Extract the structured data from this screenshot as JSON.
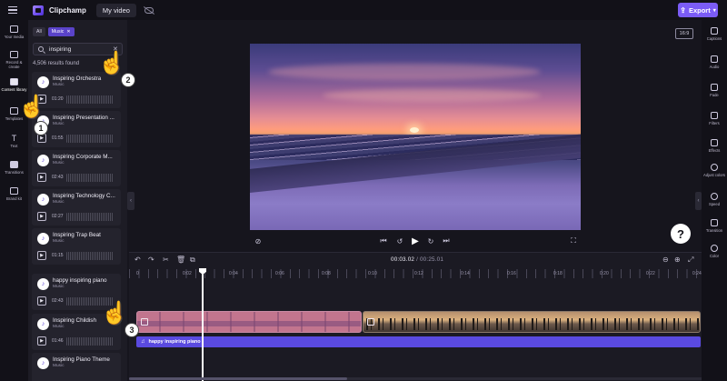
{
  "app": {
    "brand": "Clipchamp",
    "project_name": "My video",
    "export_label": "Export"
  },
  "left_rail": [
    {
      "label": "Your media",
      "icon": "media-icon"
    },
    {
      "label": "Record & create",
      "icon": "record-icon"
    },
    {
      "label": "Content library",
      "icon": "library-icon",
      "active": true
    },
    {
      "label": "Templates",
      "icon": "templates-icon"
    },
    {
      "label": "Text",
      "icon": "text-icon"
    },
    {
      "label": "Transitions",
      "icon": "transitions-icon"
    },
    {
      "label": "Brand kit",
      "icon": "brand-kit-icon"
    }
  ],
  "library": {
    "filter_all": "All",
    "filter_music": "Music",
    "search_value": "inspiring",
    "results_count": "4,506 results found",
    "items": [
      {
        "title": "Inspiring Orchestra",
        "type": "Music",
        "duration": "01:20"
      },
      {
        "title": "Inspiring Presentation ...",
        "type": "Music",
        "duration": "01:55"
      },
      {
        "title": "Inspiring Corporate M...",
        "type": "Music",
        "duration": "02:43"
      },
      {
        "title": "Inspiring Technology C...",
        "type": "Music",
        "duration": "02:27"
      },
      {
        "title": "Inspiring Trap Beat",
        "type": "Music",
        "duration": "01:15"
      },
      {
        "title": "happy inspiring piano",
        "type": "Music",
        "duration": "02:43"
      },
      {
        "title": "Inspiring Childish",
        "type": "Music",
        "duration": "01:46"
      },
      {
        "title": "Inspiring Piano Theme",
        "type": "Music",
        "duration": ""
      }
    ]
  },
  "preview": {
    "aspect_ratio": "16:9",
    "help": "?"
  },
  "right_rail": [
    {
      "label": "Captions",
      "icon": "captions-icon"
    },
    {
      "label": "Audio",
      "icon": "audio-icon"
    },
    {
      "label": "Fade",
      "icon": "fade-icon"
    },
    {
      "label": "Filters",
      "icon": "filters-icon"
    },
    {
      "label": "Effects",
      "icon": "effects-icon"
    },
    {
      "label": "Adjust colors",
      "icon": "adjust-colors-icon"
    },
    {
      "label": "Speed",
      "icon": "speed-icon"
    },
    {
      "label": "Transition",
      "icon": "transition-icon"
    },
    {
      "label": "Color",
      "icon": "color-icon"
    }
  ],
  "timeline": {
    "current_time": "00:03.02",
    "total_time": "/ 00:25.01",
    "ruler_ticks": [
      "0",
      "0:02",
      "0:04",
      "0:06",
      "0:08",
      "0:10",
      "0:12",
      "0:14",
      "0:16",
      "0:18",
      "0:20",
      "0:22",
      "0:24"
    ],
    "audio_track_name": "happy inspiring piano"
  },
  "steps": [
    "1",
    "2",
    "3"
  ],
  "colors": {
    "accent": "#7b5cf5",
    "audio_track": "#5a4ae0",
    "background": "#16151d"
  }
}
